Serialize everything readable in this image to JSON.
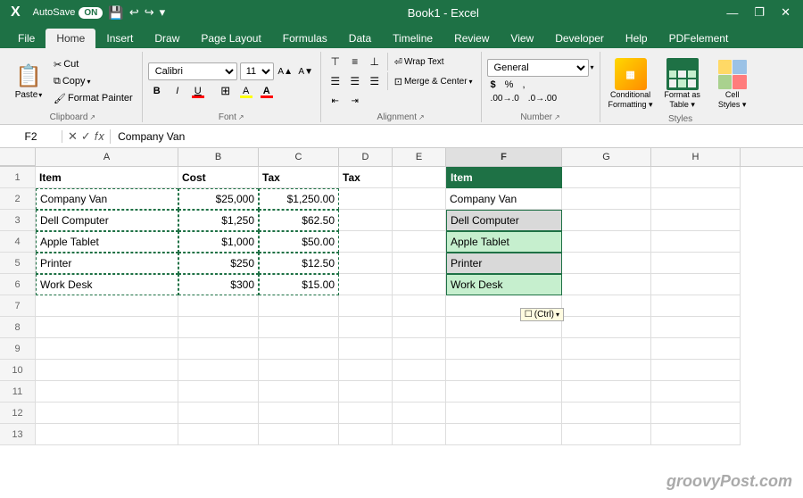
{
  "titleBar": {
    "autosave": "AutoSave",
    "toggleState": "ON",
    "title": "Book1 - Excel",
    "icons": [
      "save",
      "undo",
      "redo",
      "more"
    ]
  },
  "ribbonTabs": {
    "tabs": [
      "File",
      "Home",
      "Insert",
      "Draw",
      "Page Layout",
      "Formulas",
      "Data",
      "Timeline",
      "Review",
      "View",
      "Developer",
      "Help",
      "PDFelement"
    ],
    "activeTab": "Home"
  },
  "ribbon": {
    "groups": {
      "clipboard": {
        "label": "Clipboard"
      },
      "font": {
        "label": "Font",
        "fontName": "Calibri",
        "fontSize": "11",
        "boldLabel": "B",
        "italicLabel": "I",
        "underlineLabel": "U"
      },
      "alignment": {
        "label": "Alignment",
        "wrapText": "Wrap Text",
        "mergeCenter": "Merge & Center"
      },
      "number": {
        "label": "Number",
        "format": "General"
      },
      "styles": {
        "label": "Styles",
        "conditionalFormatting": "Conditional Formatting ~",
        "formatAsTable": "Format as Table ~",
        "cellStyles": "Cell Styles ~"
      }
    }
  },
  "formulaBar": {
    "cellRef": "F2",
    "formula": "Company Van"
  },
  "columns": {
    "headers": [
      "A",
      "B",
      "C",
      "D",
      "E",
      "F",
      "G",
      "H"
    ]
  },
  "rows": [
    {
      "num": "1",
      "cells": [
        {
          "col": "a",
          "value": "Item",
          "bold": true
        },
        {
          "col": "b",
          "value": "Cost",
          "bold": true
        },
        {
          "col": "c",
          "value": "Tax",
          "bold": true
        },
        {
          "col": "d",
          "value": "Tax",
          "bold": true
        },
        {
          "col": "e",
          "value": ""
        },
        {
          "col": "f",
          "value": "Item",
          "bold": true,
          "style": "f-header"
        },
        {
          "col": "g",
          "value": ""
        },
        {
          "col": "h",
          "value": ""
        }
      ]
    },
    {
      "num": "2",
      "cells": [
        {
          "col": "a",
          "value": "Company Van",
          "dashed": true
        },
        {
          "col": "b",
          "value": "$25,000",
          "right": true,
          "dashed": true
        },
        {
          "col": "c",
          "value": "$1,250.00",
          "right": true,
          "dashed": true
        },
        {
          "col": "d",
          "value": ""
        },
        {
          "col": "e",
          "value": ""
        },
        {
          "col": "f",
          "value": "Company Van",
          "style": "f-selected-active"
        },
        {
          "col": "g",
          "value": ""
        },
        {
          "col": "h",
          "value": ""
        }
      ]
    },
    {
      "num": "3",
      "cells": [
        {
          "col": "a",
          "value": "Dell Computer",
          "dashed": true
        },
        {
          "col": "b",
          "value": "$1,250",
          "right": true,
          "dashed": true
        },
        {
          "col": "c",
          "value": "$62.50",
          "right": true,
          "dashed": true
        },
        {
          "col": "d",
          "value": ""
        },
        {
          "col": "e",
          "value": ""
        },
        {
          "col": "f",
          "value": "Dell Computer",
          "style": "f-alt"
        },
        {
          "col": "g",
          "value": ""
        },
        {
          "col": "h",
          "value": ""
        }
      ]
    },
    {
      "num": "4",
      "cells": [
        {
          "col": "a",
          "value": "Apple Tablet",
          "dashed": true
        },
        {
          "col": "b",
          "value": "$1,000",
          "right": true,
          "dashed": true
        },
        {
          "col": "c",
          "value": "$50.00",
          "right": true,
          "dashed": true
        },
        {
          "col": "d",
          "value": ""
        },
        {
          "col": "e",
          "value": ""
        },
        {
          "col": "f",
          "value": "Apple Tablet",
          "style": "f-selected"
        },
        {
          "col": "g",
          "value": ""
        },
        {
          "col": "h",
          "value": ""
        }
      ]
    },
    {
      "num": "5",
      "cells": [
        {
          "col": "a",
          "value": "Printer",
          "dashed": true
        },
        {
          "col": "b",
          "value": "$250",
          "right": true,
          "dashed": true
        },
        {
          "col": "c",
          "value": "$12.50",
          "right": true,
          "dashed": true
        },
        {
          "col": "d",
          "value": ""
        },
        {
          "col": "e",
          "value": ""
        },
        {
          "col": "f",
          "value": "Printer",
          "style": "f-alt"
        },
        {
          "col": "g",
          "value": ""
        },
        {
          "col": "h",
          "value": ""
        }
      ]
    },
    {
      "num": "6",
      "cells": [
        {
          "col": "a",
          "value": "Work Desk",
          "dashed": true
        },
        {
          "col": "b",
          "value": "$300",
          "right": true,
          "dashed": true
        },
        {
          "col": "c",
          "value": "$15.00",
          "right": true,
          "dashed": true
        },
        {
          "col": "d",
          "value": ""
        },
        {
          "col": "e",
          "value": ""
        },
        {
          "col": "f",
          "value": "Work Desk",
          "style": "f-selected"
        },
        {
          "col": "g",
          "value": ""
        },
        {
          "col": "h",
          "value": ""
        }
      ]
    },
    {
      "num": "7",
      "cells": [
        {
          "col": "a",
          "value": ""
        },
        {
          "col": "b",
          "value": ""
        },
        {
          "col": "c",
          "value": ""
        },
        {
          "col": "d",
          "value": ""
        },
        {
          "col": "e",
          "value": ""
        },
        {
          "col": "f",
          "value": ""
        },
        {
          "col": "g",
          "value": ""
        },
        {
          "col": "h",
          "value": ""
        }
      ]
    },
    {
      "num": "8",
      "cells": [
        {
          "col": "a",
          "value": ""
        },
        {
          "col": "b",
          "value": ""
        },
        {
          "col": "c",
          "value": ""
        },
        {
          "col": "d",
          "value": ""
        },
        {
          "col": "e",
          "value": ""
        },
        {
          "col": "f",
          "value": ""
        },
        {
          "col": "g",
          "value": ""
        },
        {
          "col": "h",
          "value": ""
        }
      ]
    },
    {
      "num": "9",
      "cells": [
        {
          "col": "a",
          "value": ""
        },
        {
          "col": "b",
          "value": ""
        },
        {
          "col": "c",
          "value": ""
        },
        {
          "col": "d",
          "value": ""
        },
        {
          "col": "e",
          "value": ""
        },
        {
          "col": "f",
          "value": ""
        },
        {
          "col": "g",
          "value": ""
        },
        {
          "col": "h",
          "value": ""
        }
      ]
    },
    {
      "num": "10",
      "cells": [
        {
          "col": "a",
          "value": ""
        },
        {
          "col": "b",
          "value": ""
        },
        {
          "col": "c",
          "value": ""
        },
        {
          "col": "d",
          "value": ""
        },
        {
          "col": "e",
          "value": ""
        },
        {
          "col": "f",
          "value": ""
        },
        {
          "col": "g",
          "value": ""
        },
        {
          "col": "h",
          "value": ""
        }
      ]
    },
    {
      "num": "11",
      "cells": [
        {
          "col": "a",
          "value": ""
        },
        {
          "col": "b",
          "value": ""
        },
        {
          "col": "c",
          "value": ""
        },
        {
          "col": "d",
          "value": ""
        },
        {
          "col": "e",
          "value": ""
        },
        {
          "col": "f",
          "value": ""
        },
        {
          "col": "g",
          "value": ""
        },
        {
          "col": "h",
          "value": ""
        }
      ]
    },
    {
      "num": "12",
      "cells": [
        {
          "col": "a",
          "value": ""
        },
        {
          "col": "b",
          "value": ""
        },
        {
          "col": "c",
          "value": ""
        },
        {
          "col": "d",
          "value": ""
        },
        {
          "col": "e",
          "value": ""
        },
        {
          "col": "f",
          "value": ""
        },
        {
          "col": "g",
          "value": ""
        },
        {
          "col": "h",
          "value": ""
        }
      ]
    },
    {
      "num": "13",
      "cells": [
        {
          "col": "a",
          "value": ""
        },
        {
          "col": "b",
          "value": ""
        },
        {
          "col": "c",
          "value": ""
        },
        {
          "col": "d",
          "value": ""
        },
        {
          "col": "e",
          "value": ""
        },
        {
          "col": "f",
          "value": ""
        },
        {
          "col": "g",
          "value": ""
        },
        {
          "col": "h",
          "value": ""
        }
      ]
    }
  ],
  "pasteTooltip": "☐(Ctrl)",
  "watermark": "groovyPost.com"
}
